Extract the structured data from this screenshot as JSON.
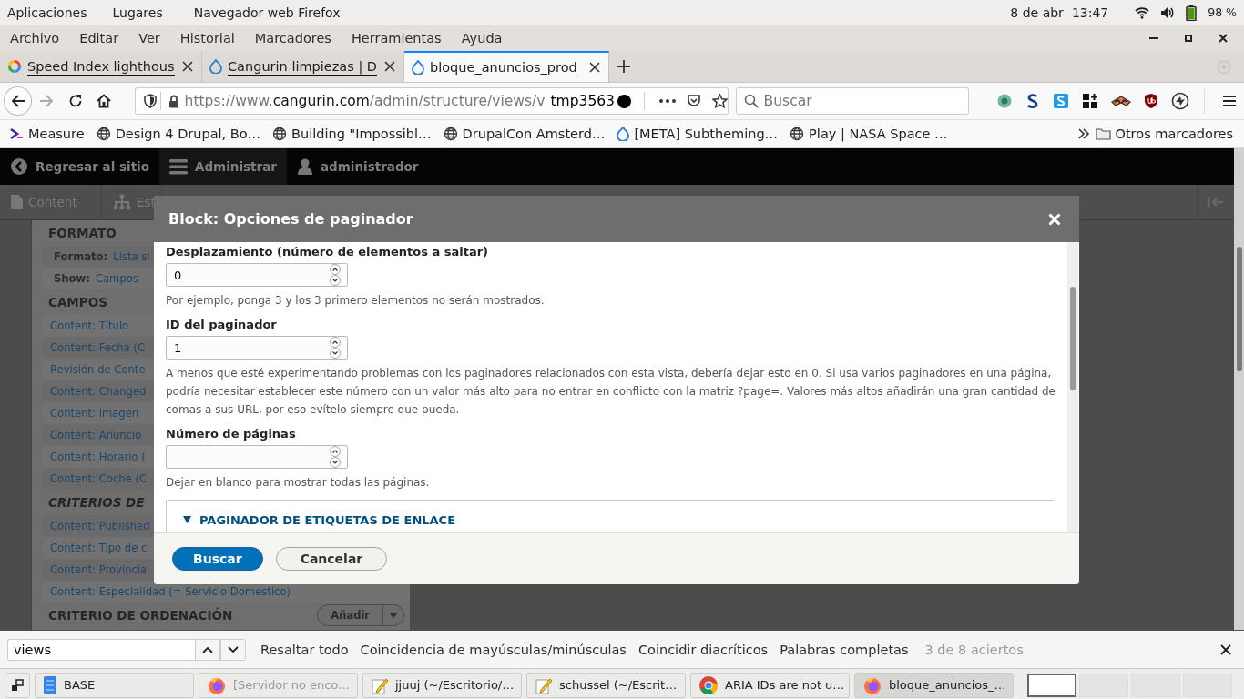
{
  "system_bar": {
    "menus": [
      "Aplicaciones",
      "Lugares",
      "Navegador web Firefox"
    ],
    "date": "8 de abr",
    "time": "13:47",
    "battery": "98 %"
  },
  "menu_bar": [
    {
      "label": "Archivo"
    },
    {
      "label": "Editar"
    },
    {
      "label": "Ver"
    },
    {
      "label": "Historial"
    },
    {
      "label": "Marcadores"
    },
    {
      "label": "Herramientas"
    },
    {
      "label": "Ayuda"
    }
  ],
  "tabs": [
    {
      "title": "Speed Index lighthous",
      "kind": "google",
      "selected": false
    },
    {
      "title": "Cangurin limpiezas | D",
      "kind": "drupal",
      "selected": false
    },
    {
      "title": "bloque_anuncios_prod",
      "kind": "drupal",
      "selected": true
    }
  ],
  "nav": {
    "url_scheme": "https://www.",
    "url_host": "cangurin.com",
    "url_path": "/admin/structure/views/v",
    "overlay_text": "tmp3563",
    "search_placeholder": "Buscar"
  },
  "bookmarks": [
    {
      "label": "Measure",
      "kind": "measure"
    },
    {
      "label": "Design 4 Drupal, Bo…",
      "kind": "globe"
    },
    {
      "label": "Building \"Impossibl…",
      "kind": "globe"
    },
    {
      "label": "DrupalCon Amsterd…",
      "kind": "globe"
    },
    {
      "label": "[META] Subtheming…",
      "kind": "drupal"
    },
    {
      "label": "Play | NASA Space …",
      "kind": "globe"
    }
  ],
  "bookmarks_other": "Otros marcadores",
  "drupal_toolbar": {
    "items": [
      "Regresar al sitio",
      "Administrar",
      "administrador"
    ],
    "tray": [
      "Content",
      "Est"
    ]
  },
  "views_panel": {
    "sections": [
      {
        "heading": "FORMATO",
        "italic": false,
        "rows": [
          {
            "kind": "setting",
            "label": "Formato:",
            "value": "Lista si"
          },
          {
            "kind": "setting",
            "label": "Show:",
            "value": "Campos"
          }
        ]
      },
      {
        "heading": "CAMPOS",
        "italic": false,
        "rows": [
          {
            "kind": "link",
            "label": "Content: Título"
          },
          {
            "kind": "link",
            "label": "Content: Fecha (C"
          },
          {
            "kind": "link",
            "label": "Revisión de Conte"
          },
          {
            "kind": "link",
            "label": "Content: Changed"
          },
          {
            "kind": "link",
            "label": "Content: imagen"
          },
          {
            "kind": "link",
            "label": "Content: Anuncio"
          },
          {
            "kind": "link",
            "label": "Content: Horario ("
          },
          {
            "kind": "link",
            "label": "Content: Coche (C"
          }
        ]
      },
      {
        "heading": "CRITERIOS DE",
        "italic": true,
        "rows": [
          {
            "kind": "link",
            "label": "Content: Published"
          },
          {
            "kind": "link",
            "label": "Content: Tipo de c"
          },
          {
            "kind": "link",
            "label": "Content: Provincia"
          },
          {
            "kind": "link",
            "label": "Content: Especialidad (= Servicio Domestico)"
          }
        ]
      },
      {
        "heading": "CRITERIO DE ORDENACIÓN",
        "italic": false,
        "action": "Añadir"
      }
    ]
  },
  "dialog": {
    "title": "Block: Opciones de paginador",
    "fields": [
      {
        "label": "Desplazamiento (número de elementos a saltar)",
        "value": "0",
        "description": "Por ejemplo, ponga 3 y los 3 primero elementos no serán mostrados."
      },
      {
        "label": "ID del paginador",
        "value": "1",
        "description": "A menos que esté experimentando problemas con los paginadores relacionados con esta vista, debería dejar esto en 0. Si usa varios paginadores en una página, podría necesitar establecer este número con un valor más alto para no entrar en conflicto con la matriz ?page=. Valores más altos añadirán una gran cantidad de comas a sus URL, por eso evítelo siempre que pueda."
      },
      {
        "label": "Número de páginas",
        "description": "Dejar en blanco para mostrar todas las páginas."
      }
    ],
    "details": {
      "summary": "PAGINADOR DE ETIQUETAS DE ENLACE",
      "expanded": true
    },
    "buttons": [
      {
        "label": "Buscar",
        "kind": "primary"
      },
      {
        "label": "Cancelar",
        "kind": "secondary"
      }
    ]
  },
  "find_bar": {
    "query": "views",
    "options": [
      {
        "label": "Resaltar todo"
      },
      {
        "label": "Coincidencia de mayúsculas/minúsculas"
      },
      {
        "label": "Coincidir diacríticos"
      },
      {
        "label": "Palabras completas"
      }
    ],
    "status": "3 de 8 aciertos"
  },
  "taskbar": {
    "windows": [
      {
        "title": "BASE",
        "kind": "base",
        "selected": false,
        "dimmed": false
      },
      {
        "title": "[Servidor no enco…",
        "kind": "firefox",
        "selected": false,
        "dimmed": true
      },
      {
        "title": "jjuuj (~/Escritorio/…",
        "kind": "editor",
        "selected": false,
        "dimmed": false
      },
      {
        "title": "schussel (~/Escrit…",
        "kind": "editor",
        "selected": false,
        "dimmed": false
      },
      {
        "title": "ARIA IDs are not u…",
        "kind": "chrome",
        "selected": false,
        "dimmed": false
      },
      {
        "title": "bloque_anuncios_…",
        "kind": "firefox",
        "selected": true,
        "dimmed": false
      }
    ],
    "workspaces": [
      {
        "selected": true
      },
      {
        "selected": false
      },
      {
        "selected": false
      },
      {
        "selected": false
      }
    ]
  }
}
